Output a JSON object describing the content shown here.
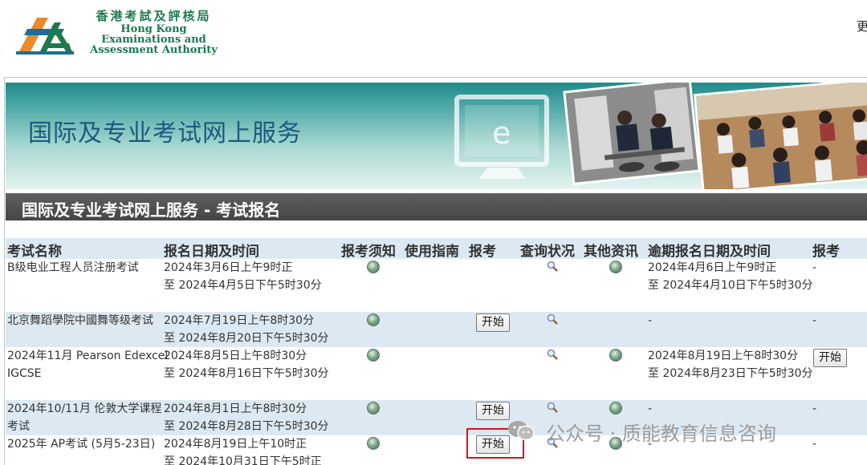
{
  "header": {
    "logo_cn": "香港考試及評核局",
    "logo_en_line1": "Hong Kong",
    "logo_en_line2": "Examinations and",
    "logo_en_line3": "Assessment Authority",
    "top_right_text": "更"
  },
  "banner": {
    "title": "国际及专业考试网上服务"
  },
  "section": {
    "title": "国际及专业考试网上服务 - 考试报名"
  },
  "table": {
    "headers": [
      "考试名称",
      "报名日期及时间",
      "报考须知",
      "使用指南",
      "报考",
      "查询状况",
      "其他资讯",
      "逾期报名日期及时间",
      "报考"
    ],
    "rows": [
      {
        "name_line1": "B级电业工程人员注册考试",
        "name_line2": "",
        "date_line1": "2024年3月6日上午9时正",
        "date_line2": "至 2024年4月5日下午5时30分",
        "notice_icon": "globe-icon",
        "apply_button": "",
        "query_icon": "magnifier-icon",
        "info_icon": "globe-icon",
        "late_line1": "2024年4月6日上午9时正",
        "late_line2": "至 2024年4月10日下午5时30分",
        "late_apply": "-"
      },
      {
        "name_line1": "北京舞蹈學院中國舞等级考试",
        "name_line2": "",
        "date_line1": "2024年7月19日上午8时30分",
        "date_line2": "至 2024年8月20日下午5时30分",
        "notice_icon": "globe-icon",
        "apply_button": "开始",
        "query_icon": "magnifier-icon",
        "info_icon": "",
        "late_line1": "-",
        "late_line2": "",
        "late_apply": "-"
      },
      {
        "name_line1": "2024年11月 Pearson Edexcel",
        "name_line2": "IGCSE",
        "date_line1": "2024年8月5日上午8时30分",
        "date_line2": "至 2024年8月16日下午5时30分",
        "notice_icon": "globe-icon",
        "apply_button": "",
        "query_icon": "magnifier-icon",
        "info_icon": "globe-icon",
        "late_line1": "2024年8月19日上午8时30分",
        "late_line2": "至 2024年8月23日下午5时30分",
        "late_apply": "开始"
      },
      {
        "name_line1": "2024年10/11月 伦敦大学课程",
        "name_line2": "考试",
        "date_line1": "2024年8月1日上午8时30分",
        "date_line2": "至 2024年8月28日下午5时30分",
        "notice_icon": "globe-icon",
        "apply_button": "开始",
        "query_icon": "magnifier-icon",
        "info_icon": "globe-icon",
        "late_line1": "-",
        "late_line2": "",
        "late_apply": "-"
      },
      {
        "name_line1": "2025年 AP考试 (5月5-23日)",
        "name_line2": "",
        "date_line1": "2024年8月19日上午10时正",
        "date_line2": "至 2024年10月31日下午5时正",
        "notice_icon": "globe-icon",
        "apply_button": "开始",
        "query_icon": "magnifier-icon",
        "info_icon": "globe-icon",
        "late_line1": "-",
        "late_line2": "",
        "late_apply": "-"
      }
    ]
  },
  "watermark": {
    "text": "公众号 · 质能教育信息咨询"
  },
  "colors": {
    "brand_green": "#1d7a4e",
    "banner_title": "#1a5b7d",
    "section_bar": "#4e4e4e",
    "table_header_bg": "#dde9f2",
    "highlight_red": "#d8141c"
  }
}
